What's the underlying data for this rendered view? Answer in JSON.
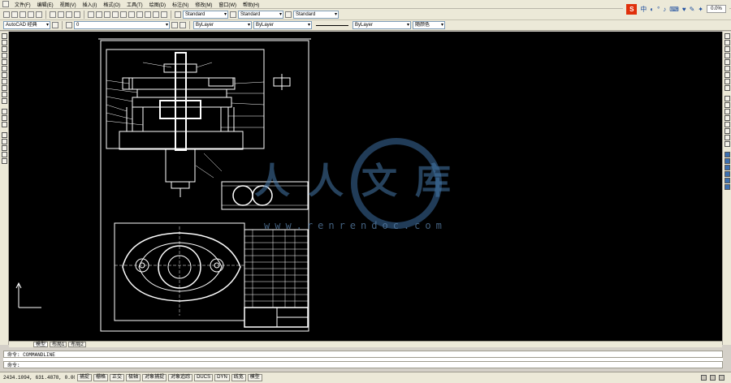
{
  "menubar": {
    "items": [
      "文件(F)",
      "编辑(E)",
      "视图(V)",
      "插入(I)",
      "格式(O)",
      "工具(T)",
      "绘图(D)",
      "标注(N)",
      "修改(M)",
      "窗口(W)",
      "帮助(H)"
    ]
  },
  "toolbar1": {
    "text_style": "Standard",
    "dim_style": "Standard",
    "table_style": "Standard"
  },
  "ime": {
    "logo": "S",
    "zoom": "0.0%"
  },
  "toolbar2": {
    "workspace": "AutoCAD 经典",
    "layer": "0",
    "color": "ByLayer",
    "linetype": "ByLayer",
    "lineweight": "ByLayer",
    "plot_style": "随颜色"
  },
  "watermark": {
    "text": "人人文库",
    "url": "www.renrendoc.com"
  },
  "layout_tabs": [
    "模型",
    "布局1",
    "布局2"
  ],
  "command": {
    "line1": "命令: COMMANDLINE",
    "line2": "命令:"
  },
  "statusbar": {
    "coords": "2434.1094, 631.4878, 0.0000",
    "buttons": [
      "捕捉",
      "栅格",
      "正交",
      "极轴",
      "对象捕捉",
      "对象追踪",
      "DUCS",
      "DYN",
      "线宽",
      "模型"
    ]
  },
  "colors": {
    "canvas": "#000000",
    "chrome": "#ece9d8",
    "watermark": "#4678aa",
    "ime_logo": "#e0300b"
  }
}
